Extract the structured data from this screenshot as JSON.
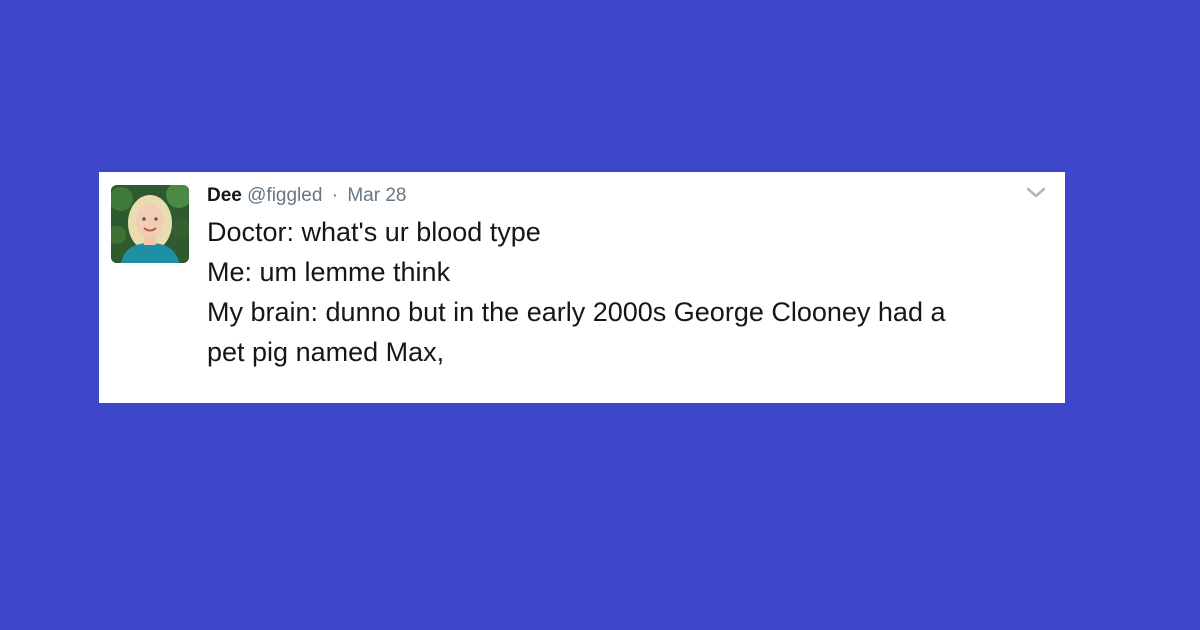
{
  "background_color": "#3e47c9",
  "tweet": {
    "display_name": "Dee",
    "handle": "@figgled",
    "separator": "·",
    "date": "Mar 28",
    "lines": [
      "Doctor: what's ur blood type",
      "Me: um lemme think",
      "My brain: dunno but in the early 2000s George Clooney had a",
      "pet pig named Max,"
    ],
    "caret_icon": "chevron-down-icon"
  }
}
